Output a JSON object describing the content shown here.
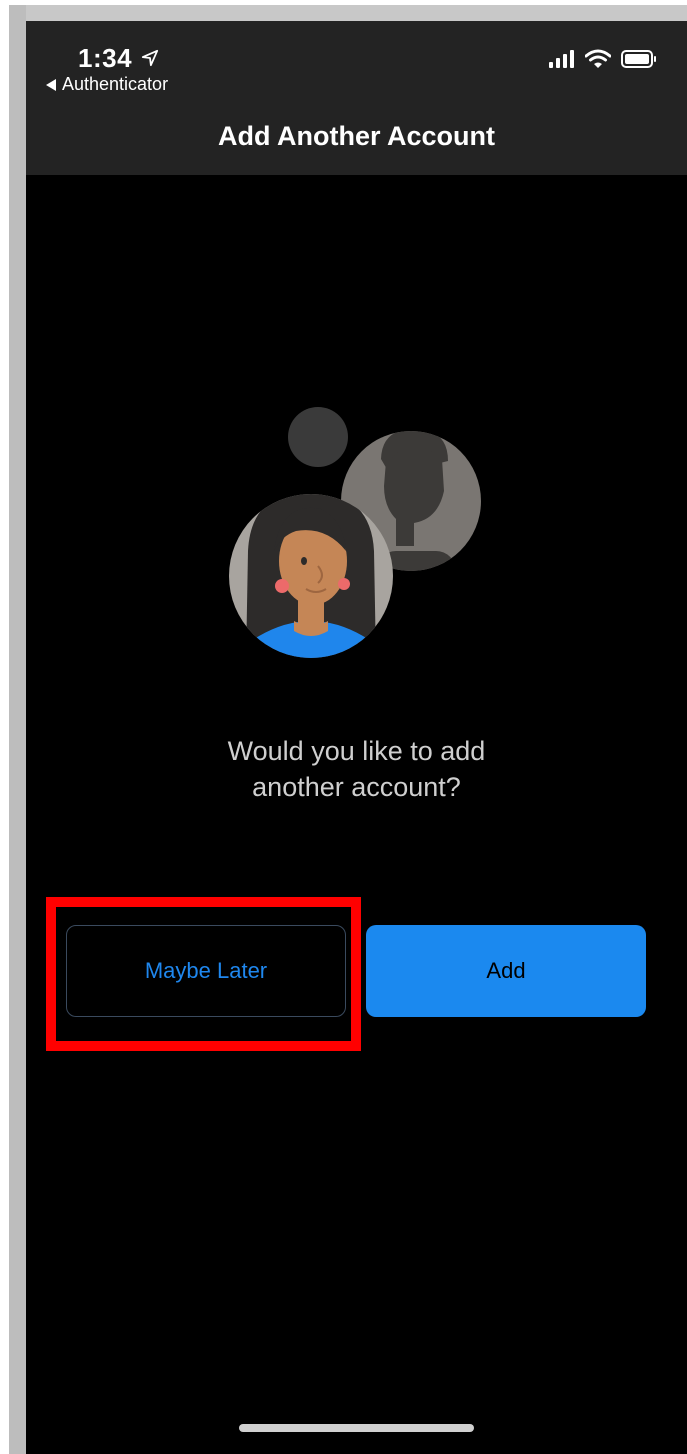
{
  "status_bar": {
    "time": "1:34",
    "back_app": "Authenticator"
  },
  "nav": {
    "title": "Add Another Account"
  },
  "prompt": {
    "line1": "Would you like to add",
    "line2": "another account?"
  },
  "buttons": {
    "later_label": "Maybe Later",
    "add_label": "Add"
  },
  "colors": {
    "accent": "#1b89ef",
    "highlight": "#ff0000",
    "header_bg": "#232323",
    "background": "#000000"
  }
}
